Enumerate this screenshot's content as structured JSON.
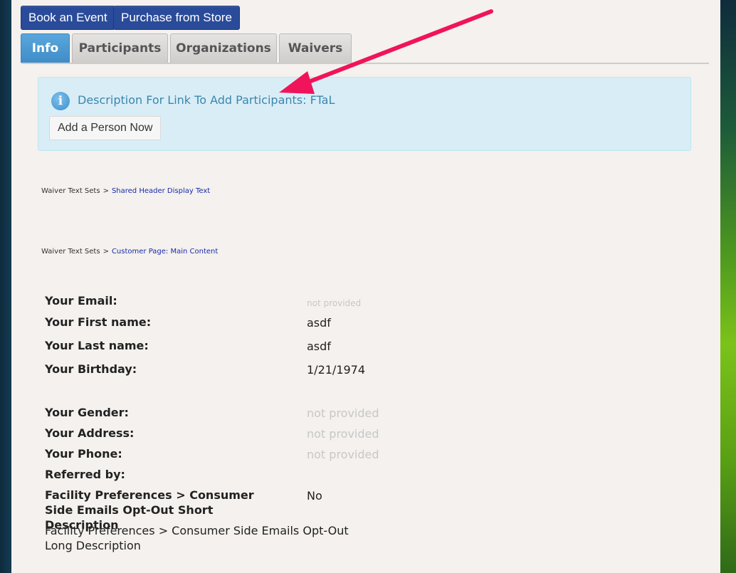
{
  "buttons": {
    "book_event": "Book an Event",
    "purchase_store": "Purchase from Store"
  },
  "tabs": [
    {
      "label": "Info",
      "active": true
    },
    {
      "label": "Participants",
      "active": false
    },
    {
      "label": "Organizations",
      "active": false
    },
    {
      "label": "Waivers",
      "active": false
    }
  ],
  "alert": {
    "icon": "info-icon",
    "text": "Description For Link To Add Participants: FTaL",
    "button": "Add a Person Now"
  },
  "breadcrumbs": [
    {
      "root": "Waiver Text Sets",
      "sep": ">",
      "link": "Shared Header Display Text"
    },
    {
      "root": "Waiver Text Sets",
      "sep": ">",
      "link": "Customer Page: Main Content"
    }
  ],
  "fields": {
    "email": {
      "label": "Your Email:",
      "value": "not provided"
    },
    "first_name": {
      "label": "Your First name:",
      "value": "asdf"
    },
    "last_name": {
      "label": "Your Last name:",
      "value": "asdf"
    },
    "birthday": {
      "label": "Your Birthday:",
      "value": "1/21/1974"
    },
    "gender": {
      "label": "Your Gender:",
      "value": "not provided"
    },
    "address": {
      "label": "Your Address:",
      "value": "not provided"
    },
    "phone": {
      "label": "Your Phone:",
      "value": "not provided"
    },
    "referred": {
      "label": "Referred by:",
      "value": ""
    },
    "optout_short": {
      "label": "Facility Preferences > Consumer Side Emails Opt-Out Short Description",
      "value": "No"
    },
    "optout_long": {
      "label": "Facility Preferences > Consumer Side Emails Opt-Out Long Description",
      "value": ""
    }
  },
  "colors": {
    "primary_button": "#2a4b9a",
    "active_tab": "#4a98d4",
    "alert_bg": "#d9edf7",
    "alert_text": "#3a87ad",
    "annotation_arrow": "#f0145a",
    "link": "#1a2aa8"
  }
}
